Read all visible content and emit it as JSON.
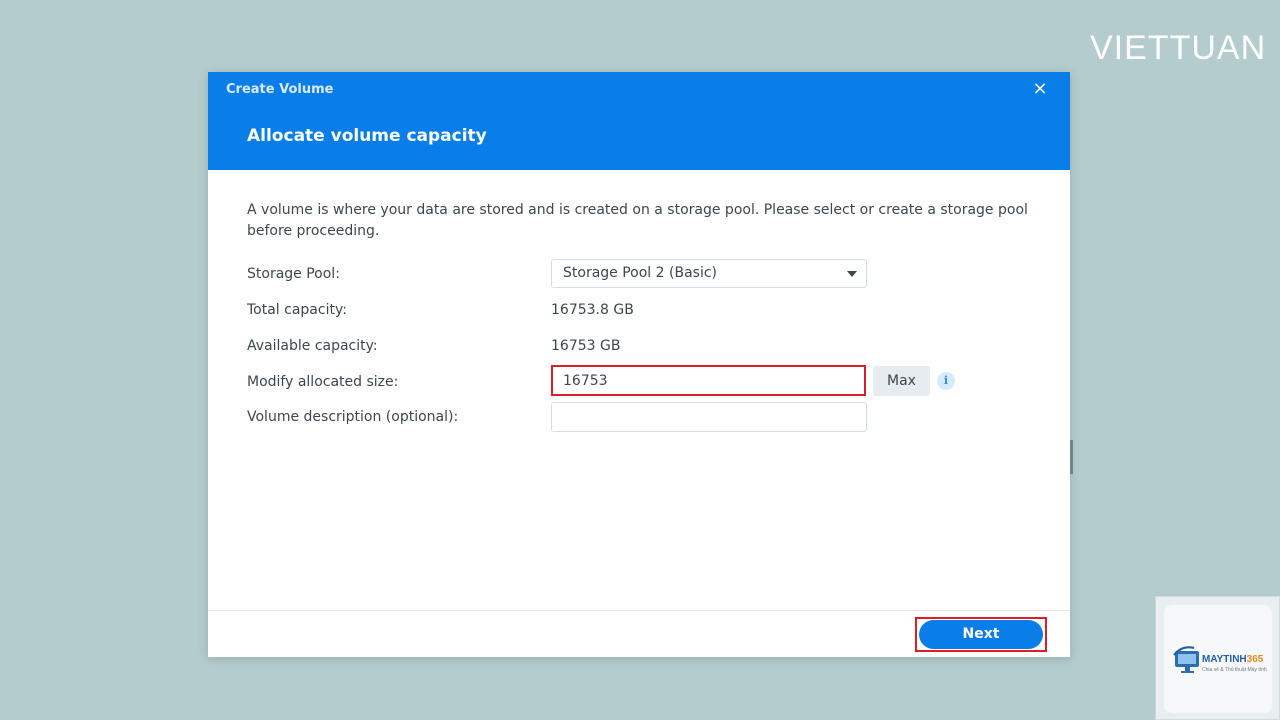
{
  "watermark": {
    "brand": "VIETTUAN"
  },
  "dialog": {
    "window_title": "Create Volume",
    "close_glyph": "×",
    "step_title": "Allocate volume capacity",
    "description": "A volume is where your data are stored and is created on a storage pool. Please select or create a storage pool before proceeding.",
    "fields": {
      "storage_pool_label": "Storage Pool:",
      "storage_pool_value": "Storage Pool 2 (Basic)",
      "total_capacity_label": "Total capacity:",
      "total_capacity_value": "16753.8 GB",
      "available_capacity_label": "Available capacity:",
      "available_capacity_value": "16753 GB",
      "allocated_size_label": "Modify allocated size:",
      "allocated_size_value": "16753",
      "max_button_label": "Max",
      "info_glyph": "i",
      "volume_description_label": "Volume description (optional):",
      "volume_description_value": ""
    },
    "footer": {
      "next_label": "Next"
    }
  },
  "logo": {
    "name_main": "MAYTINH",
    "name_accent": "365",
    "tagline": "Chia sẻ & Thủ thuật Máy tính"
  },
  "colors": {
    "accent": "#0a7ee8",
    "highlight": "#d9202a",
    "background": "#b4cccd"
  }
}
